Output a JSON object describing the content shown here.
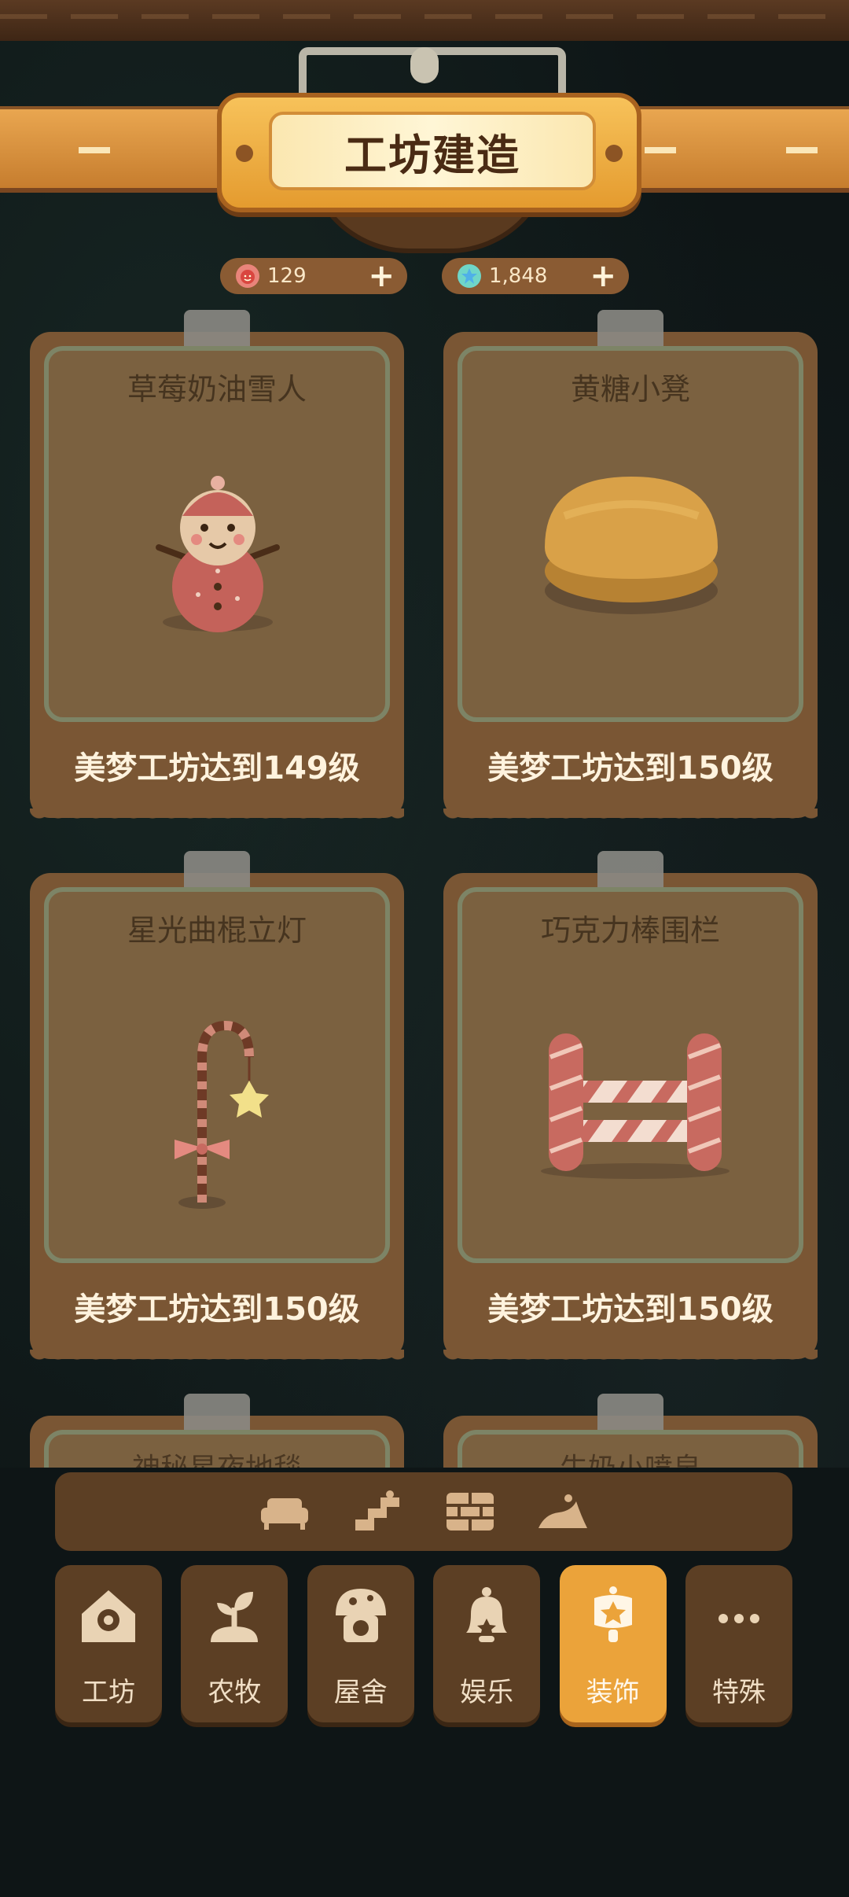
{
  "header": {
    "title": "工坊建造"
  },
  "currency": [
    {
      "icon": "strawberry-coin-icon",
      "value": "129",
      "plus": "+"
    },
    {
      "icon": "star-gem-icon",
      "value": "1,848",
      "plus": "+"
    }
  ],
  "cards": [
    {
      "name": "草莓奶油雪人",
      "requirement": "美梦工坊达到149级",
      "icon": "snowman-icon"
    },
    {
      "name": "黄糖小凳",
      "requirement": "美梦工坊达到150级",
      "icon": "stool-icon"
    },
    {
      "name": "星光曲棍立灯",
      "requirement": "美梦工坊达到150级",
      "icon": "candy-lamp-icon"
    },
    {
      "name": "巧克力棒围栏",
      "requirement": "美梦工坊达到150级",
      "icon": "candy-fence-icon"
    },
    {
      "name": "神秘星夜地毯",
      "requirement": "",
      "icon": ""
    },
    {
      "name": "牛奶小喷泉",
      "requirement": "",
      "icon": ""
    }
  ],
  "subtabs": [
    "sofa-icon",
    "stairs-icon",
    "brick-wall-icon",
    "ground-icon"
  ],
  "nav": [
    {
      "label": "工坊",
      "icon": "house-gear-icon"
    },
    {
      "label": "农牧",
      "icon": "sprout-icon"
    },
    {
      "label": "屋舍",
      "icon": "mushroom-house-icon"
    },
    {
      "label": "娱乐",
      "icon": "bell-icon"
    },
    {
      "label": "装饰",
      "icon": "lantern-icon",
      "active": true
    },
    {
      "label": "特殊",
      "icon": "more-icon"
    }
  ]
}
